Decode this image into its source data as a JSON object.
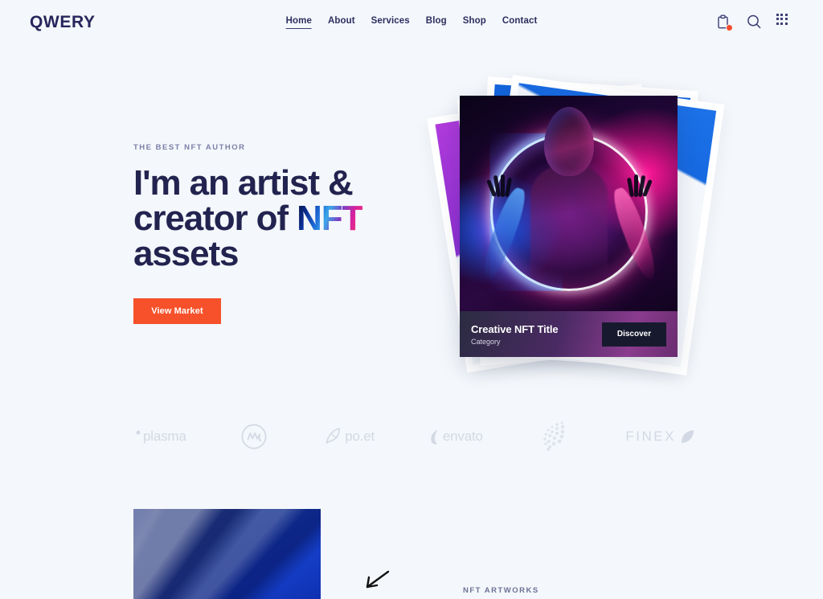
{
  "brand": {
    "logo_text": "QWERY"
  },
  "nav": {
    "items": [
      {
        "label": "Home",
        "active": true
      },
      {
        "label": "About",
        "active": false
      },
      {
        "label": "Services",
        "active": false
      },
      {
        "label": "Blog",
        "active": false
      },
      {
        "label": "Shop",
        "active": false
      },
      {
        "label": "Contact",
        "active": false
      }
    ]
  },
  "header_icons": [
    {
      "name": "cart-icon",
      "badge": true
    },
    {
      "name": "search-icon",
      "badge": false
    },
    {
      "name": "grid-menu-icon",
      "badge": false
    }
  ],
  "hero": {
    "eyebrow": "THE BEST NFT AUTHOR",
    "title_line1": "I'm an artist &",
    "title_line2_pre": "creator of ",
    "title_highlight": "NFT",
    "title_line3": "assets",
    "cta_label": "View Market"
  },
  "nft_card": {
    "title": "Creative NFT Title",
    "category": "Category",
    "button_label": "Discover"
  },
  "partners": [
    {
      "name": "plasma",
      "label": "plasma",
      "style": "plasma"
    },
    {
      "name": "coinmarketcap",
      "label": "",
      "style": "mark"
    },
    {
      "name": "poet",
      "label": "po.et",
      "style": "poet"
    },
    {
      "name": "envato",
      "label": "envato",
      "style": "envato"
    },
    {
      "name": "iota",
      "label": "",
      "style": "iota"
    },
    {
      "name": "finex",
      "label": "FINEX",
      "style": "finex"
    }
  ],
  "artworks_section": {
    "label": "NFT ARTWORKS"
  },
  "colors": {
    "background": "#f4f7fb",
    "text_dark": "#22234f",
    "accent_orange": "#f6512a",
    "nav_text": "#2d2e5f",
    "muted": "#7b7fa6",
    "logo_gray": "#d6dbe6"
  }
}
